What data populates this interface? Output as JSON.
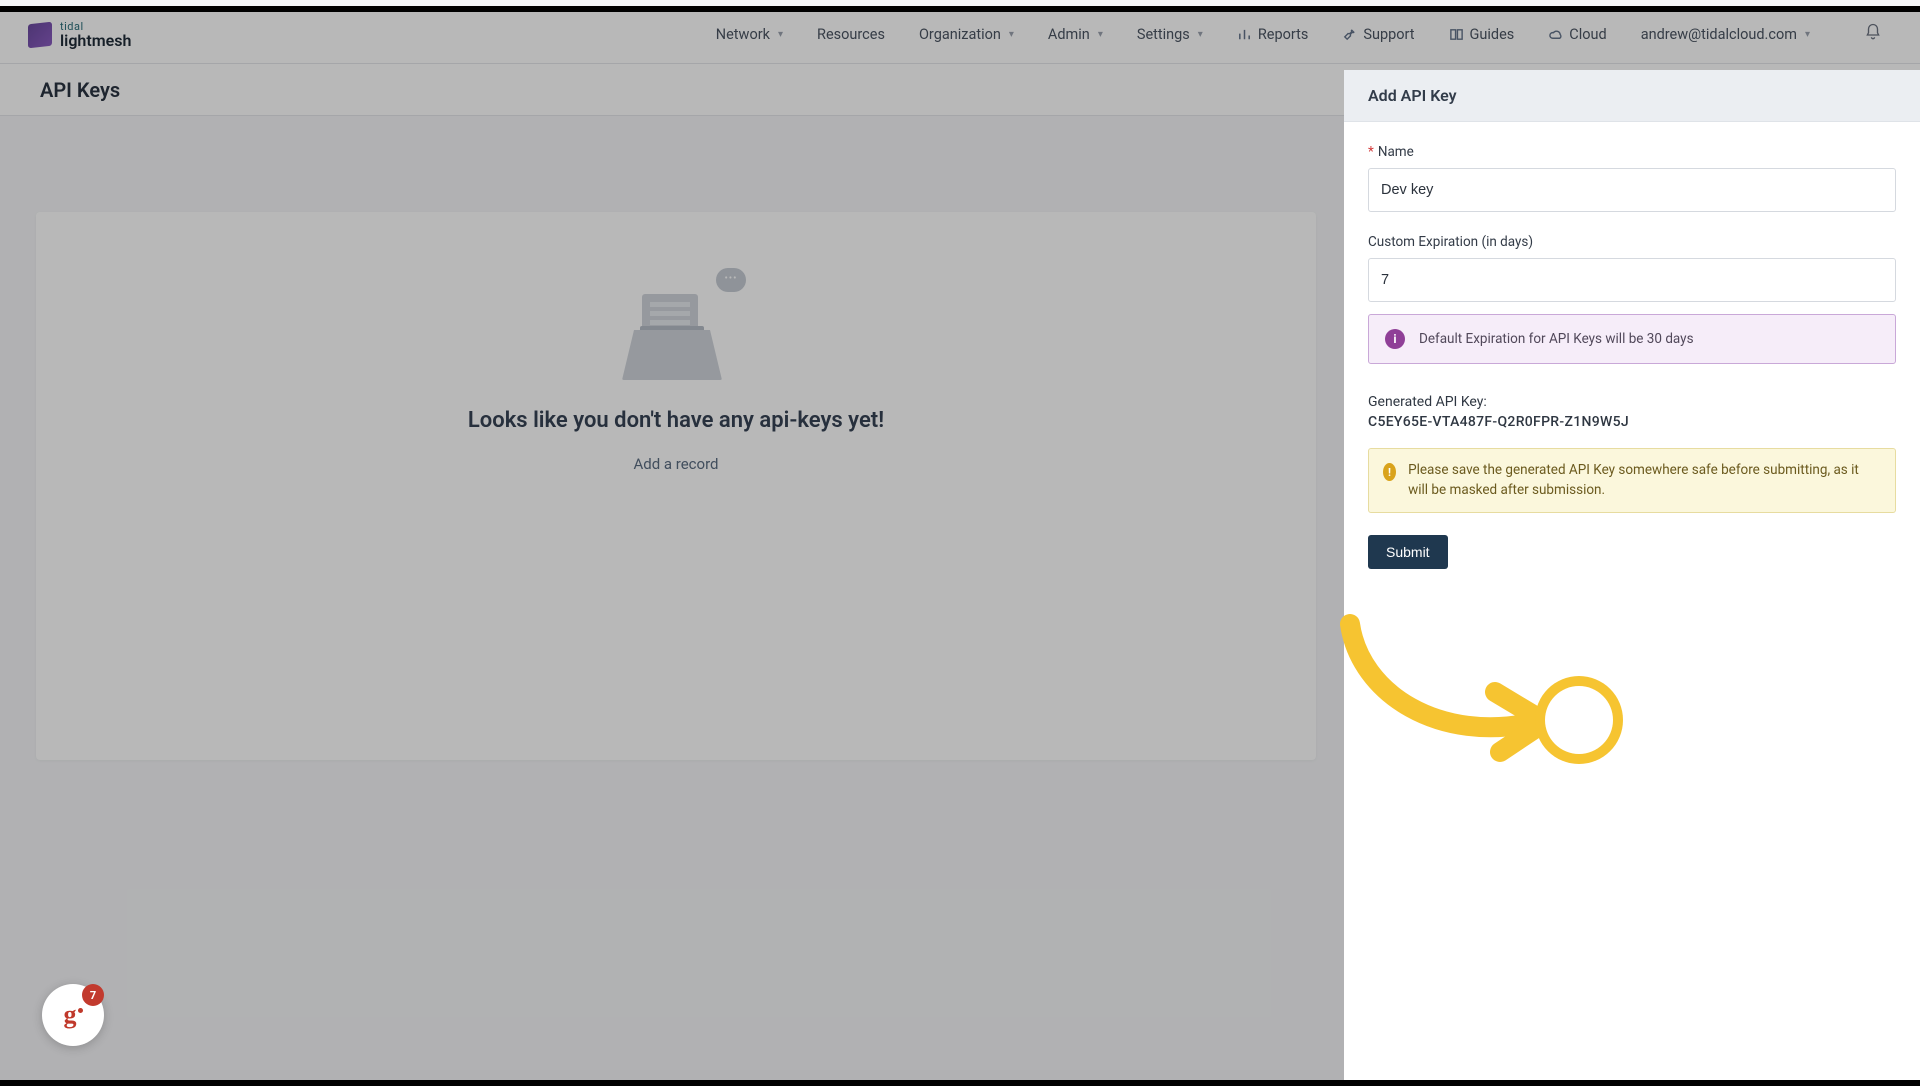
{
  "brand": {
    "top": "tidal",
    "bottom": "lightmesh"
  },
  "nav": {
    "network": "Network",
    "resources": "Resources",
    "organization": "Organization",
    "admin": "Admin",
    "settings": "Settings",
    "reports": "Reports",
    "support": "Support",
    "guides": "Guides",
    "cloud": "Cloud",
    "user_email": "andrew@tidalcloud.com"
  },
  "page": {
    "title": "API Keys"
  },
  "empty": {
    "headline": "Looks like you don't have any api-keys yet!",
    "add_link": "Add a record"
  },
  "drawer": {
    "title": "Add API Key",
    "name_label": "Name",
    "name_value": "Dev key",
    "exp_label": "Custom Expiration (in days)",
    "exp_value": "7",
    "info_text": "Default Expiration for API Keys will be 30 days",
    "gen_label": "Generated API Key:",
    "gen_key": "C5EY65E-VTA487F-Q2R0FPR-Z1N9W5J",
    "warn_text": "Please save the generated API Key somewhere safe before submitting, as it will be masked after submission.",
    "submit": "Submit"
  },
  "guru": {
    "badge": "7"
  }
}
